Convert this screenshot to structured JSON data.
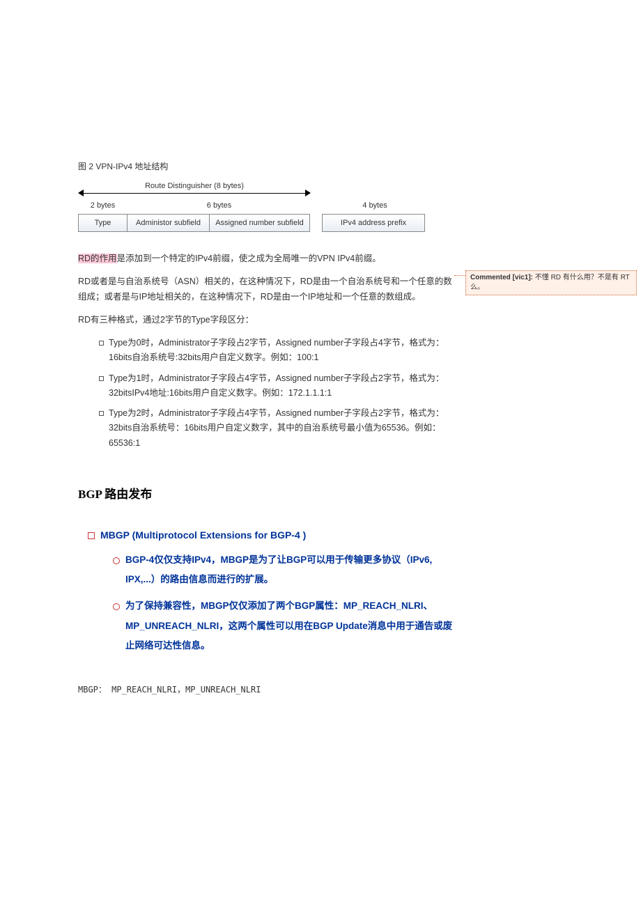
{
  "figure": {
    "caption": "图 2 VPN-IPv4 地址结构",
    "arrow_label": "Route Distinguisher (8 bytes)",
    "bytes": {
      "col1": "2 bytes",
      "col2": "6 bytes",
      "col3": "4 bytes"
    },
    "cells": {
      "c1": "Type",
      "c2": "Administor subfield",
      "c3": "Assigned number subfield",
      "c4": "IPv4 address prefix"
    }
  },
  "para1_highlight": "RD的作用",
  "para1_rest": "是添加到一个特定的IPv4前缀，使之成为全局唯一的VPN IPv4前缀。",
  "para2": "RD或者是与自治系统号（ASN）相关的，在这种情况下，RD是由一个自治系统号和一个任意的数组成；或者是与IP地址相关的，在这种情况下，RD是由一个IP地址和一个任意的数组成。",
  "para3": "RD有三种格式，通过2字节的Type字段区分：",
  "list": {
    "item1": "Type为0时，Administrator子字段占2字节，Assigned number子字段占4字节，格式为：16bits自治系统号:32bits用户自定义数字。例如：100:1",
    "item2": "Type为1时，Administrator子字段占4字节，Assigned number子字段占2字节，格式为：32bitsIPv4地址:16bits用户自定义数字。例如：172.1.1.1:1",
    "item3": "Type为2时，Administrator子字段占4字节，Assigned number子字段占2字节，格式为：32bits自治系统号：16bits用户自定义数字，其中的自治系统号最小值为65536。例如：65536:1"
  },
  "section_title": "BGP 路由发布",
  "slide": {
    "heading": "MBGP (Multiprotocol Extensions for BGP-4 )",
    "item1": "BGP-4仅仅支持IPv4，MBGP是为了让BGP可以用于传输更多协议（IPv6, IPX,...）的路由信息而进行的扩展。",
    "item2": "为了保持兼容性，MBGP仅仅添加了两个BGP属性：MP_REACH_NLRI、MP_UNREACH_NLRI，这两个属性可以用在BGP Update消息中用于通告或废止网络可达性信息。"
  },
  "mono_note": "MBGP： MP_REACH_NLRI，MP_UNREACH_NLRI",
  "comment": {
    "label": "Commented [vic1]:",
    "text": " 不懂 RD 有什么用？不是有 RT 么。"
  }
}
